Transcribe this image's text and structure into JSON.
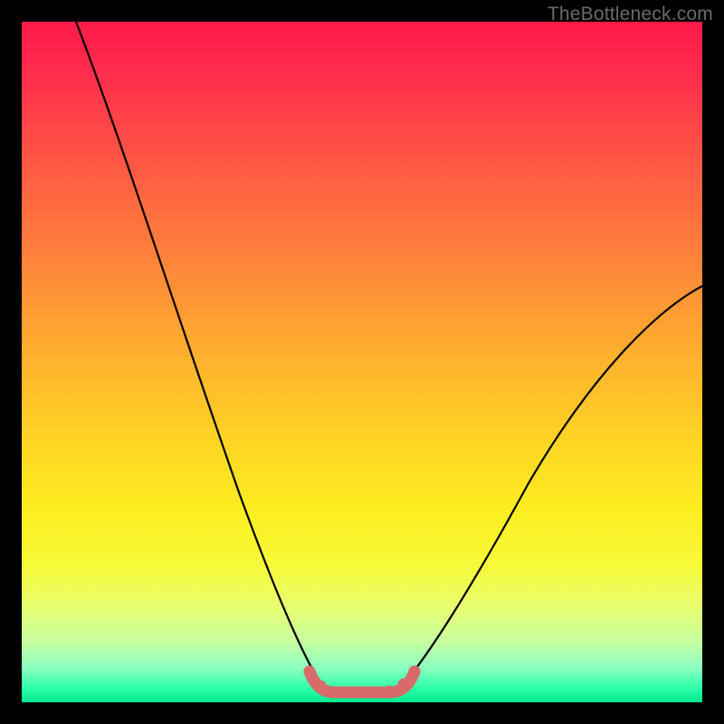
{
  "watermark": "TheBottleneck.com",
  "chart_data": {
    "type": "line",
    "title": "",
    "xlabel": "",
    "ylabel": "",
    "xlim": [
      0,
      100
    ],
    "ylim": [
      0,
      100
    ],
    "series": [
      {
        "name": "left-curve",
        "x": [
          8,
          12,
          16,
          20,
          24,
          28,
          32,
          36,
          40,
          42,
          44
        ],
        "values": [
          100,
          88,
          75,
          62,
          50,
          38,
          27,
          17,
          8,
          4,
          2
        ]
      },
      {
        "name": "right-curve",
        "x": [
          56,
          58,
          62,
          68,
          74,
          80,
          86,
          92,
          98,
          100
        ],
        "values": [
          2,
          4,
          8,
          15,
          23,
          32,
          41,
          50,
          58,
          61
        ]
      },
      {
        "name": "trough-highlight",
        "x": [
          42,
          44,
          46,
          48,
          50,
          52,
          54,
          56,
          58
        ],
        "values": [
          4,
          2,
          1.5,
          1.5,
          1.5,
          1.5,
          1.5,
          2,
          4
        ]
      }
    ],
    "colors": {
      "curve": "#000000",
      "trough": "#d86a6a",
      "background_top": "#ff1a4a",
      "background_bottom": "#00e890"
    }
  }
}
